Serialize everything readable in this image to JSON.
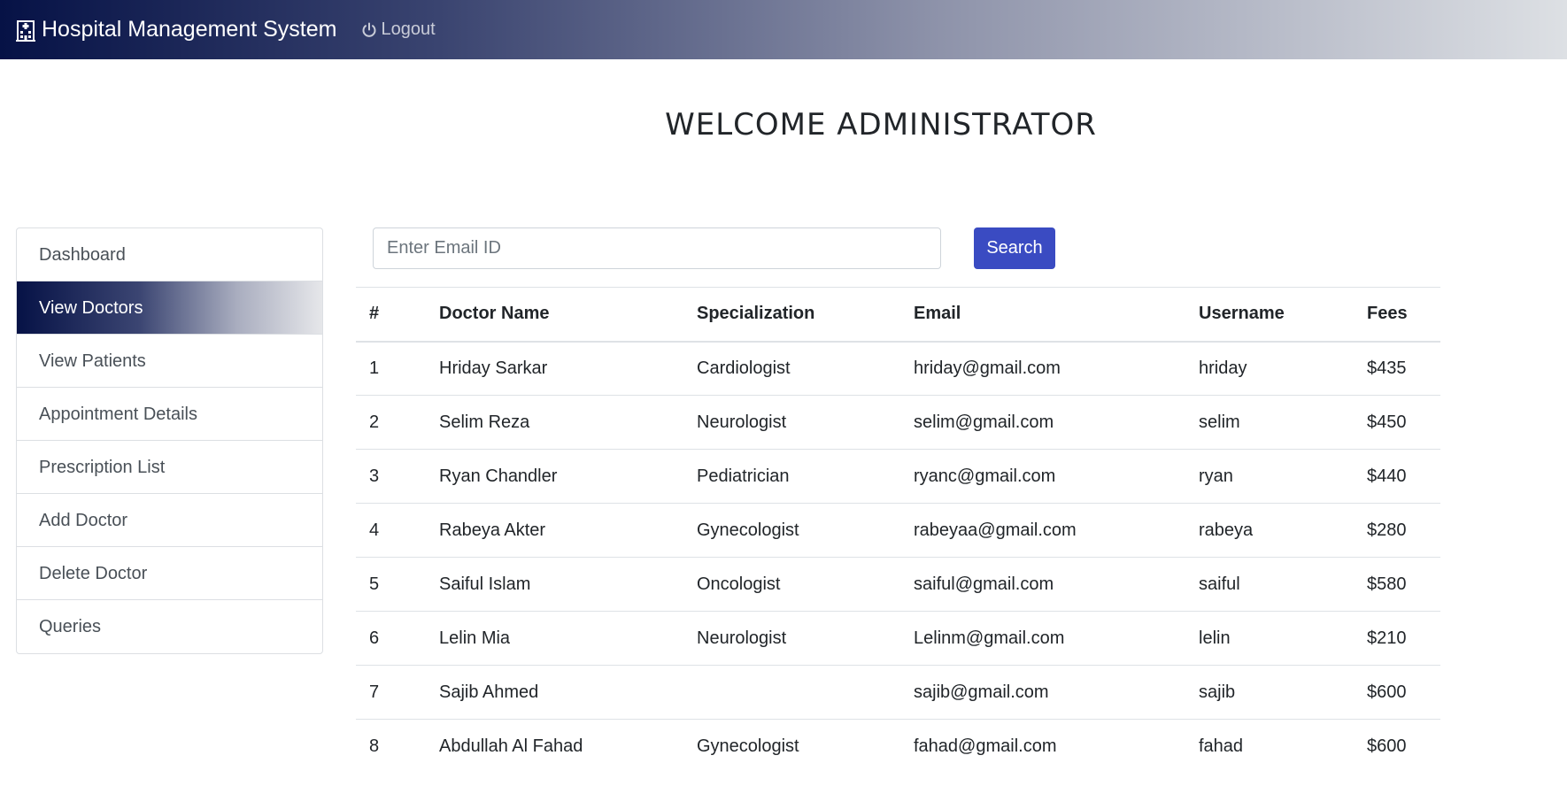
{
  "navbar": {
    "brand": "Hospital Management System",
    "brand_icon": "hospital-building-icon",
    "logout_label": "Logout",
    "logout_icon": "power-icon"
  },
  "welcome": "WELCOME ADMINISTRATOR",
  "sidebar": {
    "items": [
      {
        "label": "Dashboard",
        "active": false
      },
      {
        "label": "View Doctors",
        "active": true
      },
      {
        "label": "View Patients",
        "active": false
      },
      {
        "label": "Appointment Details",
        "active": false
      },
      {
        "label": "Prescription List",
        "active": false
      },
      {
        "label": "Add Doctor",
        "active": false
      },
      {
        "label": "Delete Doctor",
        "active": false
      },
      {
        "label": "Queries",
        "active": false
      }
    ]
  },
  "search": {
    "placeholder": "Enter Email ID",
    "value": "",
    "button_label": "Search"
  },
  "table": {
    "headers": [
      "#",
      "Doctor Name",
      "Specialization",
      "Email",
      "Username",
      "Fees"
    ],
    "rows": [
      [
        "1",
        "Hriday Sarkar",
        "Cardiologist",
        "hriday@gmail.com",
        "hriday",
        "$435"
      ],
      [
        "2",
        "Selim Reza",
        "Neurologist",
        "selim@gmail.com",
        "selim",
        "$450"
      ],
      [
        "3",
        "Ryan Chandler",
        "Pediatrician",
        "ryanc@gmail.com",
        "ryan",
        "$440"
      ],
      [
        "4",
        "Rabeya Akter",
        "Gynecologist",
        "rabeyaa@gmail.com",
        "rabeya",
        "$280"
      ],
      [
        "5",
        "Saiful Islam",
        "Oncologist",
        "saiful@gmail.com",
        "saiful",
        "$580"
      ],
      [
        "6",
        "Lelin Mia",
        "Neurologist",
        "Lelinm@gmail.com",
        "lelin",
        "$210"
      ],
      [
        "7",
        "Sajib Ahmed",
        "",
        "sajib@gmail.com",
        "sajib",
        "$600"
      ],
      [
        "8",
        "Abdullah Al Fahad",
        "Gynecologist",
        "fahad@gmail.com",
        "fahad",
        "$600"
      ]
    ]
  },
  "colors": {
    "navbar_dark": "#061246",
    "primary_button": "#3a4bc2",
    "border": "#dee2e6"
  }
}
